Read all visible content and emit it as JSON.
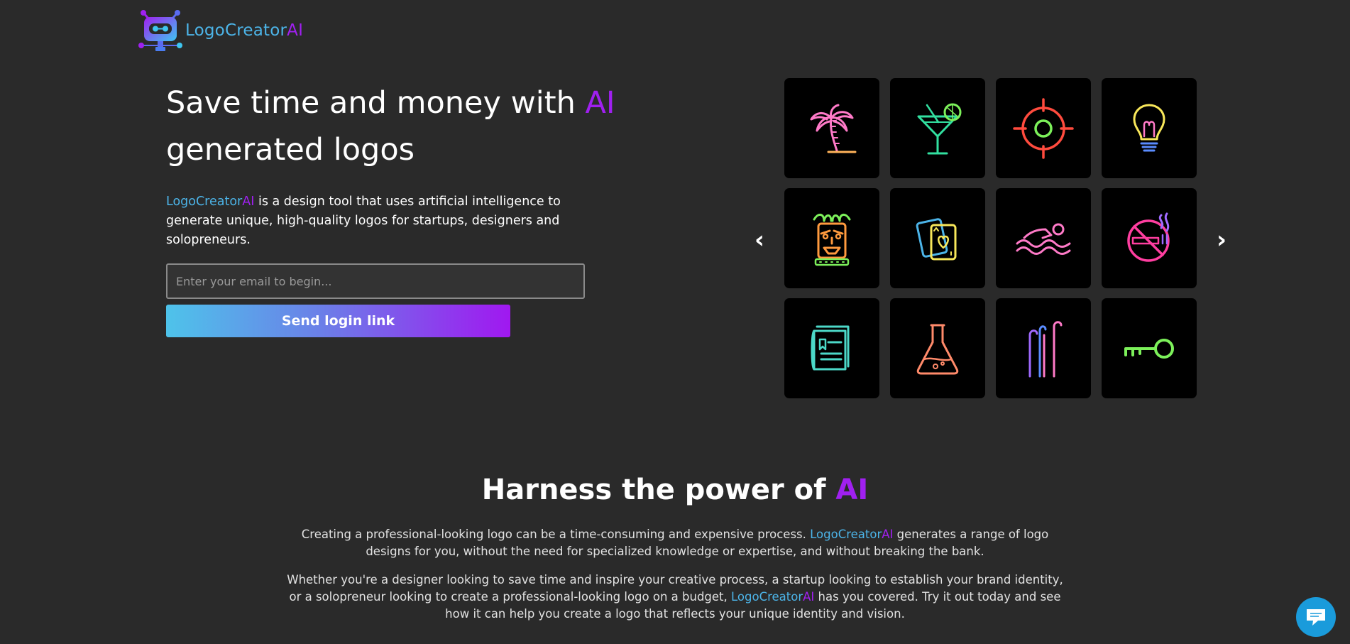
{
  "header": {
    "brand_prefix": "LogoCreator",
    "brand_suffix": "AI"
  },
  "hero": {
    "title_part1": "Save time and money with ",
    "title_highlight": "AI",
    "title_part2": "generated logos",
    "desc_brand_prefix": "LogoCreator",
    "desc_brand_suffix": "AI",
    "desc_rest": " is a design tool that uses artificial intelligence to generate unique, high-quality logos for startups, designers and solopreneurs.",
    "email_placeholder": "Enter your email to begin...",
    "email_value": "",
    "send_button_label": "Send login link"
  },
  "carousel": {
    "prev_label": "‹",
    "next_label": "›",
    "tiles": [
      {
        "icon": "palm-tree-icon"
      },
      {
        "icon": "cocktail-icon"
      },
      {
        "icon": "crosshair-target-icon"
      },
      {
        "icon": "lightbulb-icon"
      },
      {
        "icon": "tiki-mask-icon"
      },
      {
        "icon": "playing-cards-icon"
      },
      {
        "icon": "swimmer-icon"
      },
      {
        "icon": "no-smoking-icon"
      },
      {
        "icon": "book-icon"
      },
      {
        "icon": "flask-icon"
      },
      {
        "icon": "golf-clubs-icon"
      },
      {
        "icon": "key-icon"
      }
    ]
  },
  "section": {
    "title_part1": "Harness the power of ",
    "title_highlight": "AI",
    "p1_part1": "Creating a professional-looking logo can be a time-consuming and expensive process. ",
    "p1_brand_prefix": "LogoCreator",
    "p1_brand_suffix": "AI",
    "p1_part2": " generates a range of logo designs for you, without the need for specialized knowledge or expertise, and without breaking the bank.",
    "p2_part1": "Whether you're a designer looking to save time and inspire your creative process, a startup looking to establish your brand identity, or a solopreneur looking to create a professional-looking logo on a budget, ",
    "p2_brand_prefix": "LogoCreator",
    "p2_brand_suffix": "AI",
    "p2_part2": " has you covered. Try it out today and see how it can help you create a logo that reflects your unique identity and vision."
  },
  "chat": {
    "icon": "chat-bubble-icon"
  },
  "colors": {
    "background": "#2a2a2a",
    "brand_blue": "#4cb4e8",
    "brand_purple": "#a020f0",
    "tile_background": "#000000",
    "chat_blue": "#1a9bdb"
  }
}
